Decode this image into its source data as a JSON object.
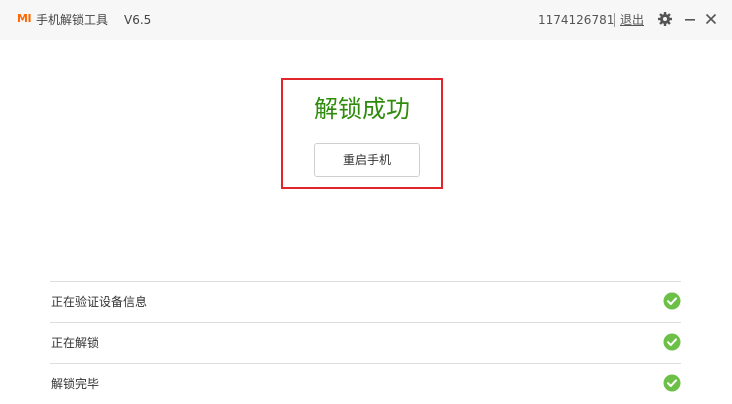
{
  "window": {
    "logo_text": "MI",
    "title": "手机解锁工具",
    "version": "V6.5",
    "account_id": "1174126781",
    "logout_label": "退出",
    "icons": [
      "gear-icon",
      "minimize-icon",
      "close-icon"
    ]
  },
  "result": {
    "title": "解锁成功",
    "restart_label": "重启手机"
  },
  "steps": [
    {
      "label": "正在验证设备信息",
      "status": "done"
    },
    {
      "label": "正在解锁",
      "status": "done"
    },
    {
      "label": "解锁完毕",
      "status": "done"
    }
  ],
  "colors": {
    "accent": "#ff6700",
    "success_text": "#2e8b0c",
    "success_icon": "#6cbf47",
    "highlight_border": "#e0262b"
  }
}
